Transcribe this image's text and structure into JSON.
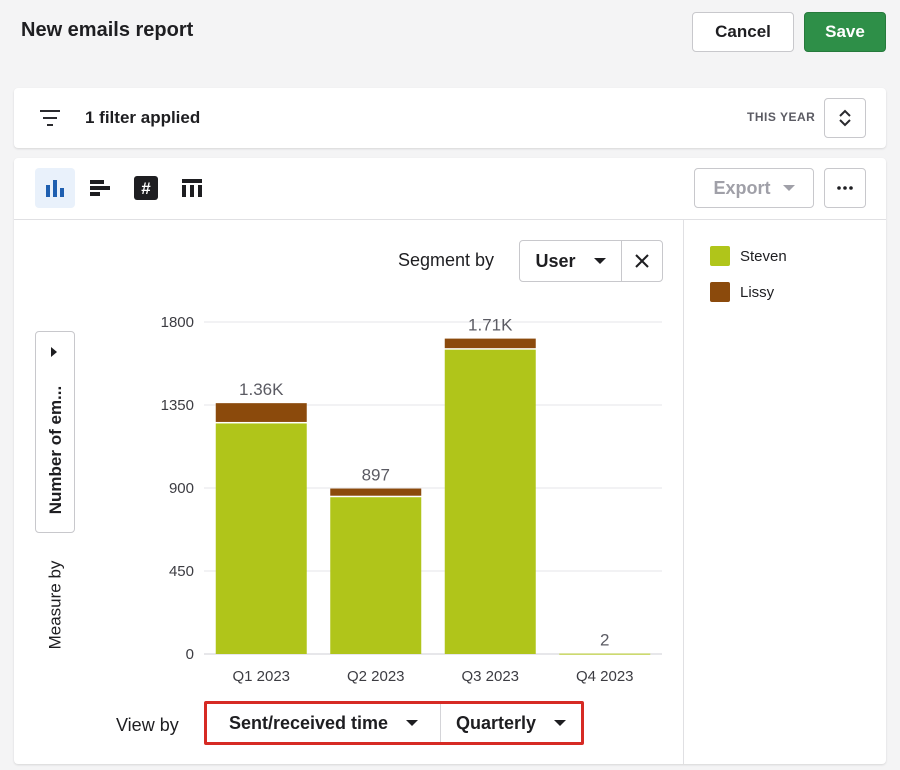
{
  "header": {
    "title": "New emails report",
    "cancel_label": "Cancel",
    "save_label": "Save"
  },
  "filter_bar": {
    "filter_text": "1 filter applied",
    "period_label": "THIS YEAR"
  },
  "toolbar": {
    "view_icons": [
      "bar-chart-icon",
      "horizontal-bar-icon",
      "number-icon",
      "table-icon"
    ],
    "export_label": "Export"
  },
  "segment": {
    "label": "Segment by",
    "value": "User"
  },
  "measure": {
    "value": "Number of em...",
    "label": "Measure by"
  },
  "view_by": {
    "label": "View by",
    "field": "Sent/received time",
    "interval": "Quarterly"
  },
  "legend": [
    {
      "name": "Steven",
      "color": "#b0c51a"
    },
    {
      "name": "Lissy",
      "color": "#8b4a0c"
    }
  ],
  "chart_data": {
    "type": "bar",
    "stacked": true,
    "categories": [
      "Q1 2023",
      "Q2 2023",
      "Q3 2023",
      "Q4 2023"
    ],
    "series": [
      {
        "name": "Steven",
        "values": [
          1250,
          850,
          1650,
          2
        ],
        "color": "#b0c51a"
      },
      {
        "name": "Lissy",
        "values": [
          110,
          47,
          60,
          0
        ],
        "color": "#8b4a0c"
      }
    ],
    "totals_labels": [
      "1.36K",
      "897",
      "1.71K",
      "2"
    ],
    "y_ticks": [
      0,
      450,
      900,
      1350,
      1800
    ],
    "ylim": [
      0,
      1800
    ],
    "grid": true
  }
}
